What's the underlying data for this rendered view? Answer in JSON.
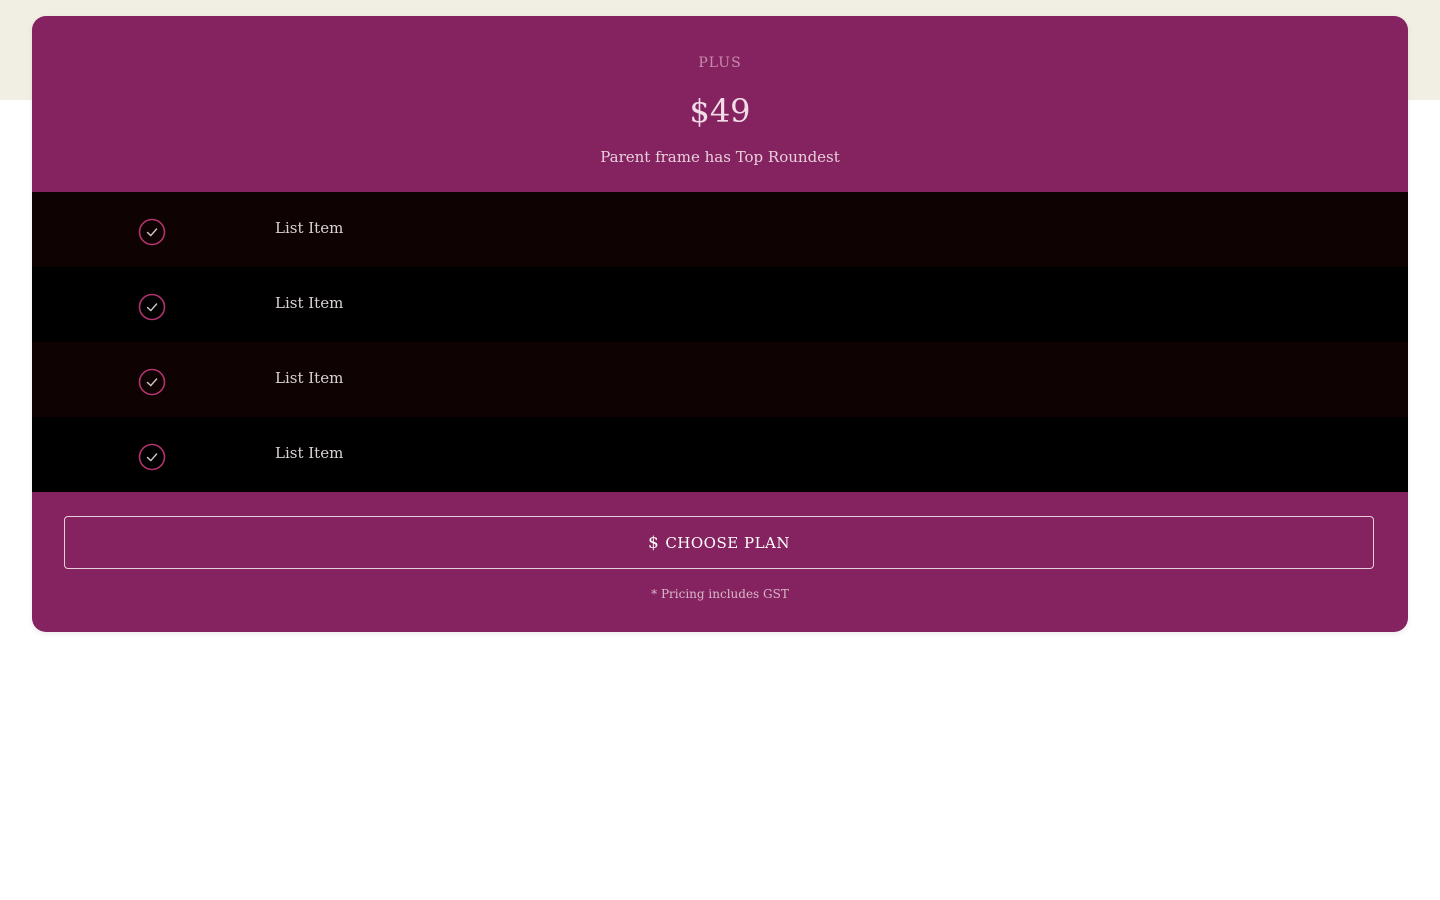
{
  "plan": {
    "name": "PLUS",
    "price": "$49",
    "description": "Parent frame has Top Roundest"
  },
  "features": [
    {
      "label": "List Item",
      "icon": "check-circle-icon"
    },
    {
      "label": "List Item",
      "icon": "check-circle-icon"
    },
    {
      "label": "List Item",
      "icon": "check-circle-icon"
    },
    {
      "label": "List Item",
      "icon": "check-circle-icon"
    }
  ],
  "cta": {
    "icon_glyph": "$",
    "icon": "dollar-icon",
    "label": "CHOOSE PLAN"
  },
  "footnote": "* Pricing includes GST",
  "colors": {
    "card": "#852360",
    "row_odd": "#0e0302",
    "row_even": "#000000",
    "check_stroke": "#b0336f",
    "page_band": "#f1efe3"
  }
}
